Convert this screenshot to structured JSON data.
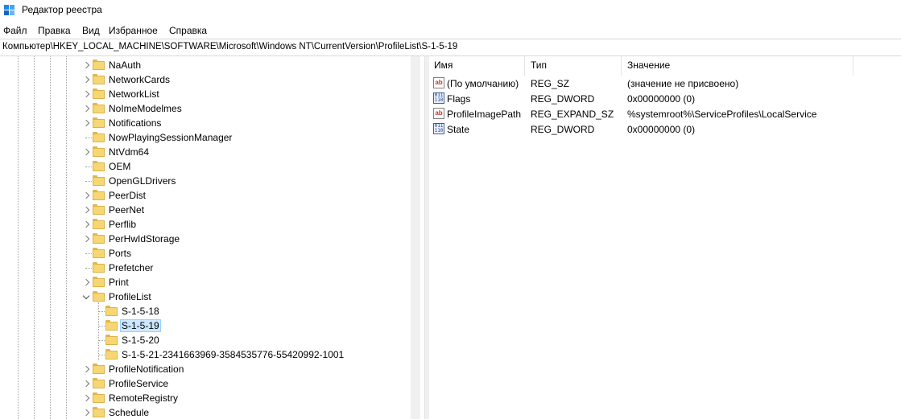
{
  "window": {
    "title": "Редактор реестра"
  },
  "menu": [
    "Файл",
    "Правка",
    "Вид",
    "Избранное",
    "Справка"
  ],
  "address": "Компьютер\\HKEY_LOCAL_MACHINE\\SOFTWARE\\Microsoft\\Windows NT\\CurrentVersion\\ProfileList\\S-1-5-19",
  "tree": [
    {
      "label": "NaAuth",
      "expander": "collapsed"
    },
    {
      "label": "NetworkCards",
      "expander": "collapsed"
    },
    {
      "label": "NetworkList",
      "expander": "collapsed"
    },
    {
      "label": "NoImeModelmes",
      "expander": "collapsed"
    },
    {
      "label": "Notifications",
      "expander": "collapsed"
    },
    {
      "label": "NowPlayingSessionManager",
      "expander": "none"
    },
    {
      "label": "NtVdm64",
      "expander": "collapsed"
    },
    {
      "label": "OEM",
      "expander": "none"
    },
    {
      "label": "OpenGLDrivers",
      "expander": "none"
    },
    {
      "label": "PeerDist",
      "expander": "collapsed"
    },
    {
      "label": "PeerNet",
      "expander": "collapsed"
    },
    {
      "label": "Perflib",
      "expander": "collapsed"
    },
    {
      "label": "PerHwIdStorage",
      "expander": "collapsed"
    },
    {
      "label": "Ports",
      "expander": "none"
    },
    {
      "label": "Prefetcher",
      "expander": "none"
    },
    {
      "label": "Print",
      "expander": "collapsed"
    },
    {
      "label": "ProfileList",
      "expander": "expanded"
    },
    {
      "label": "S-1-5-18",
      "expander": "none",
      "child": true
    },
    {
      "label": "S-1-5-19",
      "expander": "none",
      "child": true,
      "selected": true
    },
    {
      "label": "S-1-5-20",
      "expander": "none",
      "child": true
    },
    {
      "label": "S-1-5-21-2341663969-3584535776-55420992-1001",
      "expander": "none",
      "child": true
    },
    {
      "label": "ProfileNotification",
      "expander": "collapsed"
    },
    {
      "label": "ProfileService",
      "expander": "collapsed"
    },
    {
      "label": "RemoteRegistry",
      "expander": "collapsed"
    },
    {
      "label": "Schedule",
      "expander": "collapsed"
    }
  ],
  "columns": {
    "name": "Имя",
    "type": "Тип",
    "value": "Значение"
  },
  "values": [
    {
      "icon": "string-value-icon",
      "name": "(По умолчанию)",
      "type": "REG_SZ",
      "data": "(значение не присвоено)"
    },
    {
      "icon": "binary-value-icon",
      "name": "Flags",
      "type": "REG_DWORD",
      "data": "0x00000000 (0)"
    },
    {
      "icon": "string-value-icon",
      "name": "ProfileImagePath",
      "type": "REG_EXPAND_SZ",
      "data": "%systemroot%\\ServiceProfiles\\LocalService"
    },
    {
      "icon": "binary-value-icon",
      "name": "State",
      "type": "REG_DWORD",
      "data": "0x00000000 (0)"
    }
  ],
  "icon_glyphs": {
    "string": "ab",
    "binary": "011 110"
  },
  "colors": {
    "selection_bg": "#cce8ff",
    "selection_border": "#99d1ff",
    "folder": "#f7d774"
  }
}
